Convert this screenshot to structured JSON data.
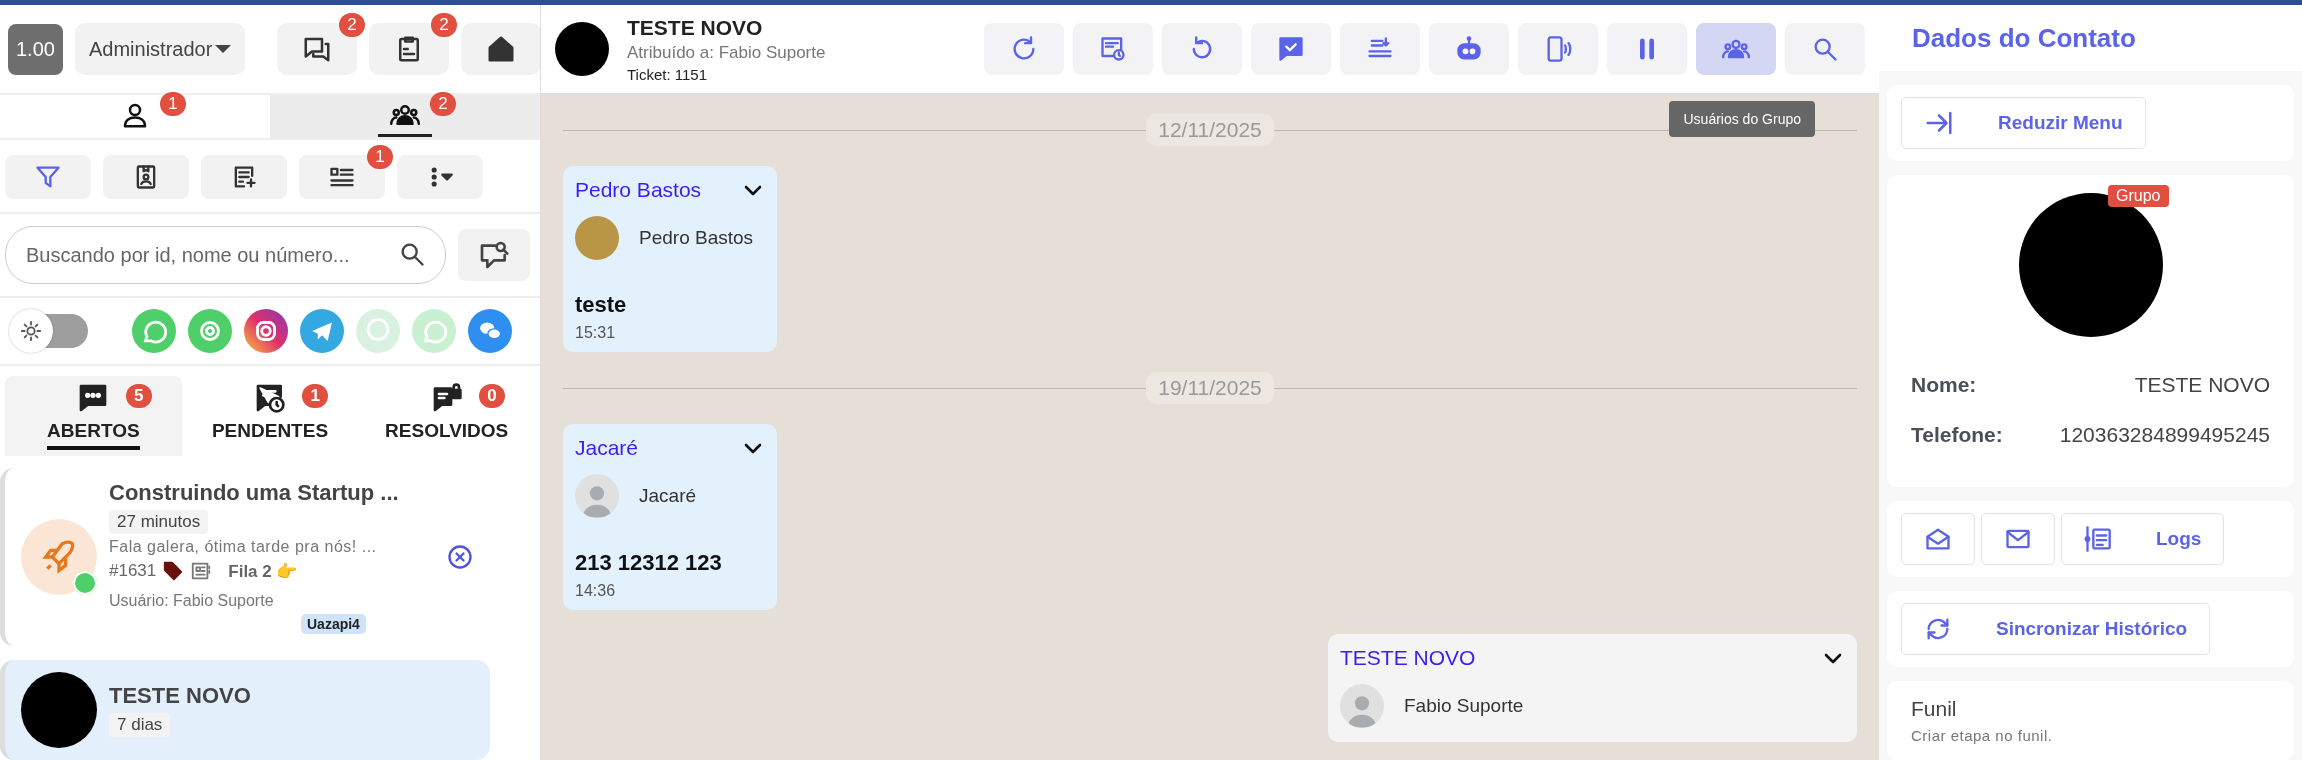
{
  "top_bar": {
    "zoom_badge": "1.00",
    "role_select": "Administrador",
    "badges": [
      "2",
      "2"
    ]
  },
  "view_tabs": [
    {
      "badge": "1",
      "selected": false
    },
    {
      "badge": "2",
      "selected": true
    }
  ],
  "toolbar": {
    "badge": "1"
  },
  "search": {
    "placeholder": "Buscando por id, nome ou número..."
  },
  "theme_toggle": {
    "on": false
  },
  "channels": [
    {
      "faded": false
    },
    {
      "faded": false
    },
    {
      "faded": false
    },
    {
      "faded": false
    },
    {
      "faded": true
    },
    {
      "faded": true
    },
    {
      "faded": false
    }
  ],
  "status_tabs": [
    {
      "label": "ABERTOS",
      "badge": "5",
      "selected": true
    },
    {
      "label": "PENDENTES",
      "badge": "1",
      "selected": false
    },
    {
      "label": "RESOLVIDOS",
      "badge": "0",
      "selected": false
    }
  ],
  "tickets": [
    {
      "title": "Construindo uma Startup ...",
      "time": "27 minutos",
      "preview": "Fala galera, ótima tarde pra nós! ...",
      "number": "#1631",
      "queue": "Fila 2 👉",
      "user": "Usuário: Fabio Suporte",
      "connection": "Uazapi4",
      "selected": false
    },
    {
      "title": "TESTE NOVO",
      "time": "7 dias",
      "selected": true
    }
  ],
  "chat_header": {
    "title": "TESTE NOVO",
    "assigned": "Atribuído a: Fabio Suporte",
    "ticket": "Ticket: 1151",
    "actions": [
      {
        "selected": false
      },
      {
        "selected": false
      },
      {
        "selected": false
      },
      {
        "selected": false
      },
      {
        "selected": false
      },
      {
        "selected": false
      },
      {
        "selected": false
      },
      {
        "selected": false
      },
      {
        "selected": true
      },
      {
        "selected": false
      }
    ],
    "tooltip": "Usuários do Grupo"
  },
  "timeline": [
    {
      "kind": "date",
      "text": "12/11/2025"
    },
    {
      "kind": "incoming",
      "sender": "Pedro Bastos",
      "contact": "Pedro Bastos",
      "text": "teste",
      "time": "15:31"
    },
    {
      "kind": "date",
      "text": "19/11/2025"
    },
    {
      "kind": "incoming",
      "sender": "Jacaré",
      "contact": "Jacaré",
      "text": "213 12312 123",
      "time": "14:36"
    },
    {
      "kind": "outgoing",
      "sender": "TESTE NOVO",
      "contact": "Fabio Suporte"
    }
  ],
  "contact_panel": {
    "title": "Dados do Contato",
    "collapse_button": "Reduzir Menu",
    "group_badge": "Grupo",
    "fields": [
      {
        "label": "Nome:",
        "value": "TESTE NOVO"
      },
      {
        "label": "Telefone:",
        "value": "120363284899495245"
      }
    ],
    "logs_button": "Logs",
    "sync_button": "Sincronizar Histórico",
    "funnel": {
      "title": "Funil",
      "hint": "Criar etapa no funil."
    }
  }
}
